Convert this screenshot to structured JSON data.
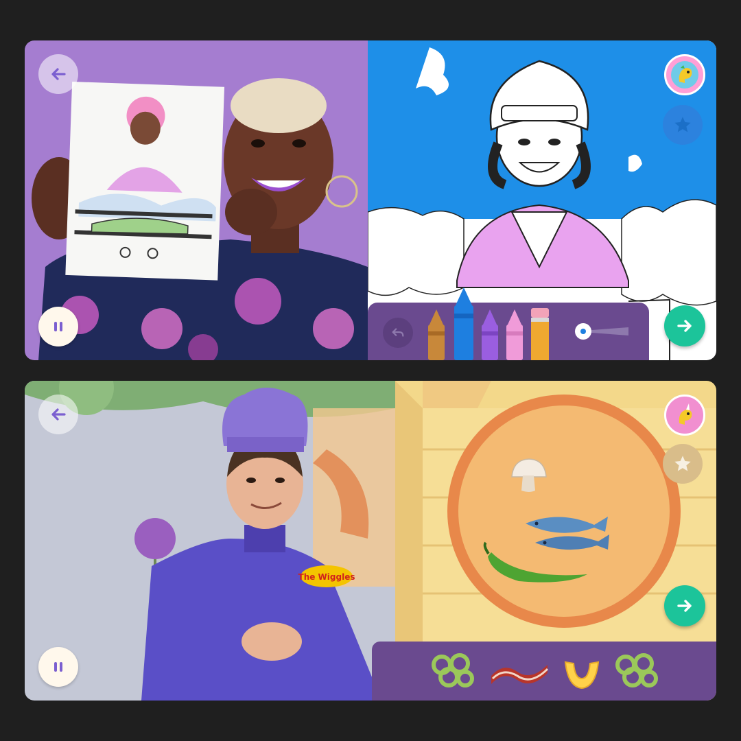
{
  "colors": {
    "background": "#1f1f1f",
    "accent_purple": "#7b5fd0",
    "next_green": "#1cc49a",
    "tray_purple": "#6a4a8f",
    "sky_blue": "#1e8fe8",
    "purple_backdrop": "#a87ed1"
  },
  "top_activity": {
    "name": "coloring",
    "icons": {
      "back": "left-arrow-icon",
      "pause": "pause-icon",
      "avatar": "dinosaur-avatar-icon",
      "star": "star-icon",
      "undo": "undo-icon",
      "next": "right-arrow-icon"
    },
    "crayons": [
      {
        "name": "brown-crayon",
        "color": "#c8883a"
      },
      {
        "name": "blue-crayon",
        "color": "#1e7fe0"
      },
      {
        "name": "purple-crayon",
        "color": "#9a5ee0"
      },
      {
        "name": "pink-crayon",
        "color": "#f09bd9"
      },
      {
        "name": "pencil",
        "color": "#f0a830"
      }
    ],
    "selected_crayon": "blue-crayon",
    "brush_size_level": 0.15
  },
  "bottom_activity": {
    "name": "pizza-making",
    "wiggles_logo_text": "The Wiggles",
    "icons": {
      "back": "left-arrow-icon",
      "pause": "pause-icon",
      "avatar": "unicorn-avatar-icon",
      "star": "star-icon",
      "next": "right-arrow-icon"
    },
    "toppings_on_pizza": [
      "mushroom",
      "fish",
      "green-chili"
    ],
    "toppings_tray": [
      "green-pepper",
      "bacon",
      "pineapple",
      "green-pepper"
    ]
  }
}
